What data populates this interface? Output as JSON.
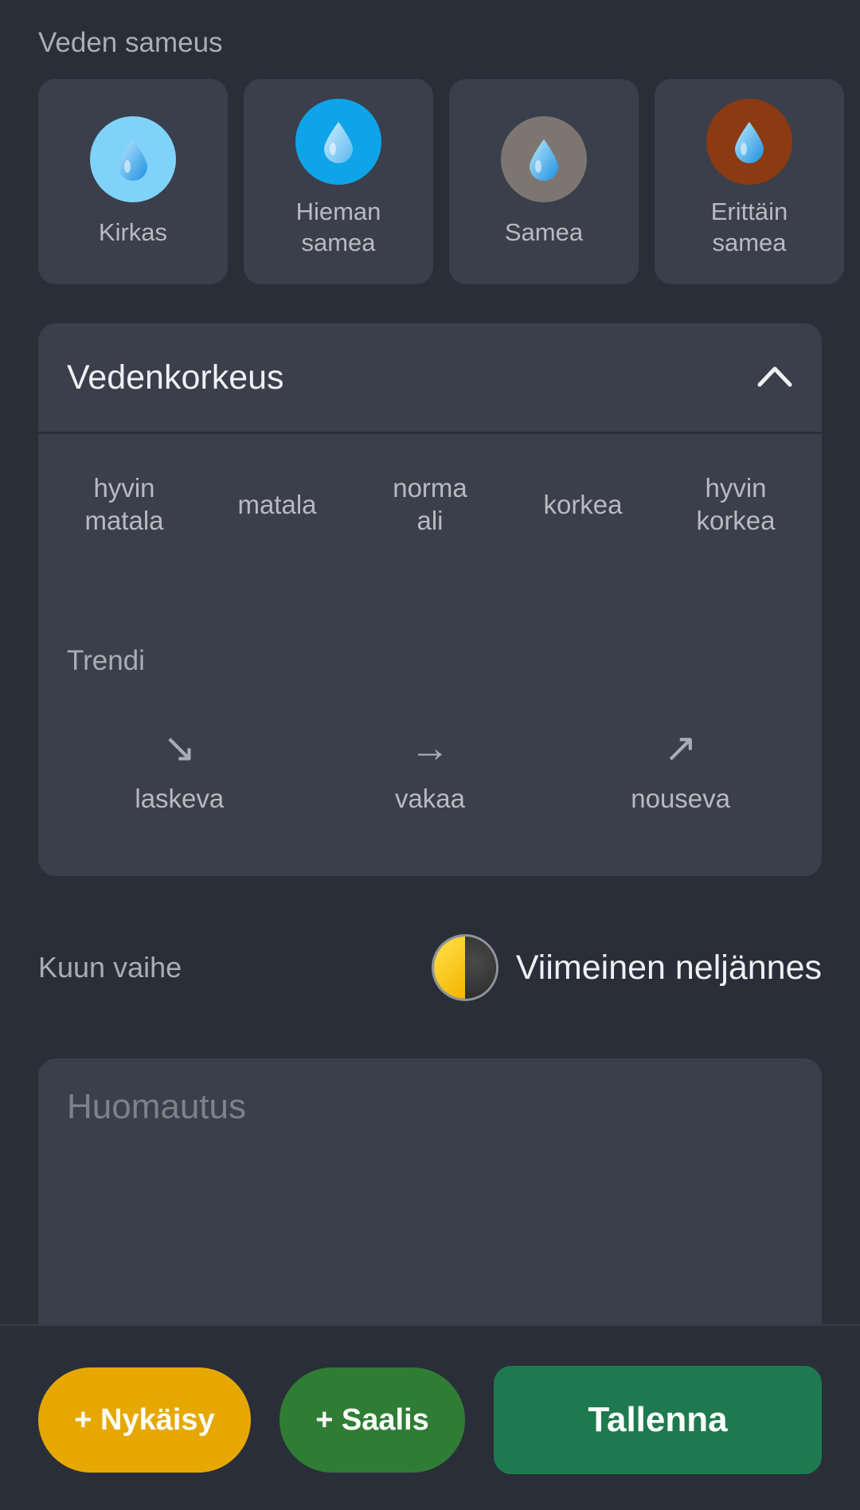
{
  "turbidity": {
    "title": "Veden sameus",
    "options": [
      {
        "label": "Kirkas",
        "color": "#7fd3fb",
        "icon": "water-drop-icon"
      },
      {
        "label": "Hieman\nsamea",
        "color": "#0fa4e8",
        "icon": "water-drop-icon"
      },
      {
        "label": "Samea",
        "color": "#7d7670",
        "icon": "water-drop-icon"
      },
      {
        "label": "Erittäin\nsamea",
        "color": "#8b3a12",
        "icon": "water-drop-icon"
      }
    ]
  },
  "water_level": {
    "title": "Vedenkorkeus",
    "expanded": true,
    "levels": [
      "hyvin\nmatala",
      "matala",
      "norma\nali",
      "korkea",
      "hyvin\nkorkea"
    ],
    "trend_title": "Trendi",
    "trends": [
      {
        "arrow": "↘",
        "label": "laskeva"
      },
      {
        "arrow": "→",
        "label": "vakaa"
      },
      {
        "arrow": "↗",
        "label": "nouseva"
      }
    ]
  },
  "moon": {
    "label": "Kuun vaihe",
    "value": "Viimeinen neljännes",
    "icon": "last-quarter-moon-icon"
  },
  "note": {
    "placeholder": "Huomautus"
  },
  "actions": {
    "strike_label": "+ Nykäisy",
    "catch_label": "+ Saalis",
    "save_label": "Tallenna",
    "colors": {
      "strike": "#e6a800",
      "catch": "#2f7d34",
      "save": "#1e7a4e"
    }
  }
}
